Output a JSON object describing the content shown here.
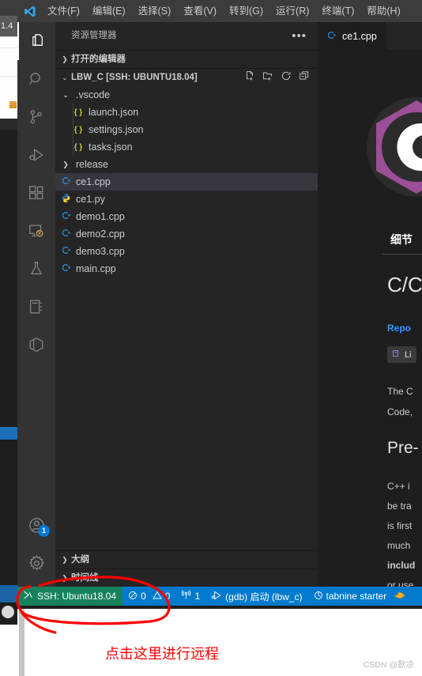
{
  "background_window": {
    "tab_label": "1.4",
    "name": "partially-visible-browser-window"
  },
  "titlebar": {
    "logo_icon": "vscode-logo-icon",
    "menus": [
      {
        "label": "文件(F)",
        "name": "menu-file"
      },
      {
        "label": "编辑(E)",
        "name": "menu-edit"
      },
      {
        "label": "选择(S)",
        "name": "menu-selection"
      },
      {
        "label": "查看(V)",
        "name": "menu-view"
      },
      {
        "label": "转到(G)",
        "name": "menu-go"
      },
      {
        "label": "运行(R)",
        "name": "menu-run"
      },
      {
        "label": "终端(T)",
        "name": "menu-terminal"
      },
      {
        "label": "帮助(H)",
        "name": "menu-help"
      }
    ]
  },
  "activitybar": {
    "items": [
      {
        "icon": "files-explorer-icon",
        "name": "activity-explorer",
        "active": true
      },
      {
        "icon": "search-icon",
        "name": "activity-search",
        "active": false
      },
      {
        "icon": "source-control-branch-icon",
        "name": "activity-source-control",
        "active": false
      },
      {
        "icon": "run-and-debug-icon",
        "name": "activity-run-debug",
        "active": false
      },
      {
        "icon": "extensions-blocks-icon",
        "name": "activity-extensions",
        "active": false
      },
      {
        "icon": "remote-explorer-monitor-icon",
        "name": "activity-remote-explorer",
        "active": false
      },
      {
        "icon": "testing-flask-icon",
        "name": "activity-testing",
        "active": false
      },
      {
        "icon": "notebook-icon",
        "name": "activity-notebook",
        "active": false
      },
      {
        "icon": "cube-package-icon",
        "name": "activity-package",
        "active": false
      }
    ],
    "account": {
      "icon": "account-person-icon",
      "badge": "1",
      "name": "activity-account"
    },
    "settings": {
      "icon": "gear-icon",
      "name": "activity-settings"
    }
  },
  "sidebar": {
    "title": "资源管理器",
    "more_icon": "ellipsis-icon",
    "open_editors": {
      "label": "打开的编辑器",
      "expanded": false
    },
    "root": {
      "label": "LBW_C [SSH: UBUNTU18.04]",
      "expanded": true,
      "actions": [
        {
          "icon": "new-file-icon",
          "name": "new-file-button"
        },
        {
          "icon": "new-folder-icon",
          "name": "new-folder-button"
        },
        {
          "icon": "refresh-icon",
          "name": "refresh-explorer-button"
        },
        {
          "icon": "collapse-all-icon",
          "name": "collapse-all-button"
        }
      ]
    },
    "tree": [
      {
        "label": ".vscode",
        "type": "folder",
        "expanded": true,
        "depth": 1,
        "icon": "chevron-down-icon"
      },
      {
        "label": "launch.json",
        "type": "json",
        "depth": 2,
        "icon": "json-braces-icon"
      },
      {
        "label": "settings.json",
        "type": "json",
        "depth": 2,
        "icon": "json-braces-icon"
      },
      {
        "label": "tasks.json",
        "type": "json",
        "depth": 2,
        "icon": "json-braces-icon"
      },
      {
        "label": "release",
        "type": "folder",
        "expanded": false,
        "depth": 1,
        "icon": "chevron-right-icon"
      },
      {
        "label": "ce1.cpp",
        "type": "cpp",
        "depth": 1,
        "icon": "cpp-file-icon",
        "selected": true
      },
      {
        "label": "ce1.py",
        "type": "py",
        "depth": 1,
        "icon": "python-file-icon"
      },
      {
        "label": "demo1.cpp",
        "type": "cpp",
        "depth": 1,
        "icon": "cpp-file-icon"
      },
      {
        "label": "demo2.cpp",
        "type": "cpp",
        "depth": 1,
        "icon": "cpp-file-icon"
      },
      {
        "label": "demo3.cpp",
        "type": "cpp",
        "depth": 1,
        "icon": "cpp-file-icon"
      },
      {
        "label": "main.cpp",
        "type": "cpp",
        "depth": 1,
        "icon": "cpp-file-icon"
      }
    ],
    "outline": {
      "label": "大纲",
      "expanded": false
    },
    "timeline": {
      "label": "时间线",
      "expanded": false
    }
  },
  "editor": {
    "tab": {
      "label": "ce1.cpp",
      "icon": "cpp-file-icon"
    },
    "extension_page": {
      "logo_icon": "cpp-extension-logo-icon",
      "details_tab": "细节",
      "heading": "C/C",
      "repo_link": "Repo",
      "license_badge": "Li",
      "license_badge_icon": "license-icon",
      "paragraph_lines": [
        "The C",
        "Code,"
      ],
      "subheading": "Pre-",
      "body_lines": [
        "C++ i",
        "be tra",
        "is first",
        "much",
        "includ",
        "or use"
      ]
    }
  },
  "statusbar": {
    "remote": {
      "icon": "remote-ssh-icon",
      "label": "SSH: Ubuntu18.04",
      "color": "#16825d"
    },
    "background_color": "#007acc",
    "items": [
      {
        "icon": "error-circle-icon",
        "label": "0",
        "name": "status-errors"
      },
      {
        "icon": "warning-triangle-icon",
        "label": "0",
        "name": "status-warnings"
      },
      {
        "icon": "radio-tower-icon",
        "label": "1",
        "name": "status-ports"
      },
      {
        "icon": "debug-start-icon",
        "label": "(gdb) 启动 (lbw_c)",
        "name": "status-debug-launch"
      },
      {
        "icon": "tabnine-icon",
        "label": "tabnine starter",
        "name": "status-tabnine"
      },
      {
        "icon": "pointing-hand-icon",
        "label": "",
        "name": "status-hand-icon"
      }
    ]
  },
  "annotations": {
    "callout_text": "点击这里进行远程",
    "callout_color": "#fe0000",
    "ellipse_target": "ssh-remote-indicator",
    "watermark": "CSDN @默凉"
  }
}
